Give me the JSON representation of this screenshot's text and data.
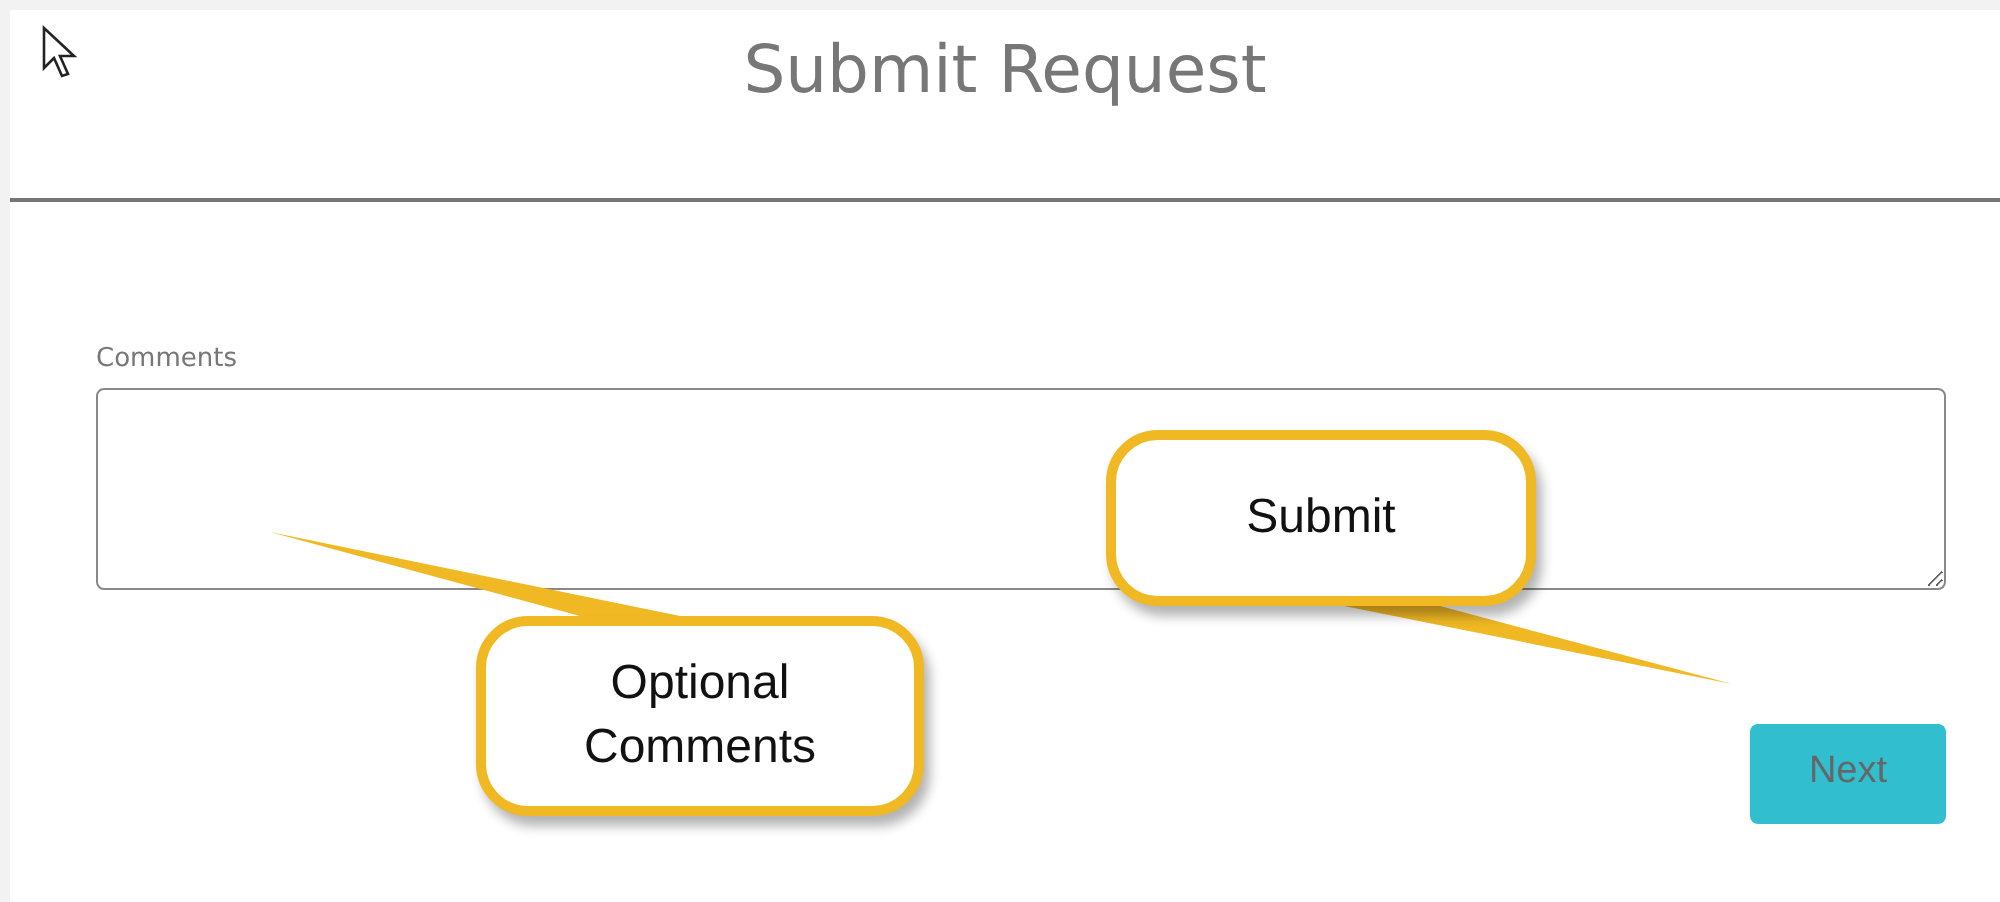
{
  "page": {
    "title": "Submit Request"
  },
  "comments_field": {
    "label": "Comments"
  },
  "next_button": {
    "label": "Next"
  },
  "callouts": [
    {
      "text": "Optional\nComments",
      "kind": "optional"
    },
    {
      "text": "Submit",
      "kind": "submit"
    }
  ]
}
